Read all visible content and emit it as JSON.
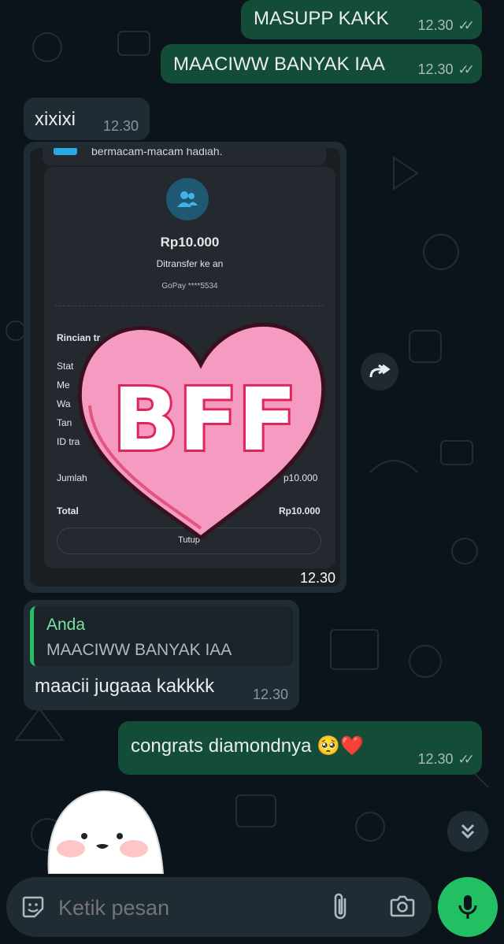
{
  "messages": [
    {
      "id": "m1",
      "direction": "out",
      "text": "MASUPP KAKK",
      "time": "12.30",
      "ticks": "✓✓"
    },
    {
      "id": "m2",
      "direction": "out",
      "text": "MAACIWW BANYAK IAA",
      "time": "12.30",
      "ticks": "✓✓"
    },
    {
      "id": "m3",
      "direction": "in",
      "text": "xixixi",
      "time": "12.30"
    },
    {
      "id": "m4",
      "direction": "in",
      "type": "image",
      "time": "12.30",
      "image": {
        "top_text": "bermacam-macam hadiah.",
        "amount": "Rp10.000",
        "transfer_label": "Ditransfer ke an",
        "account": "GoPay ****5534",
        "details_label": "Rincian tr",
        "rows": [
          "Stat",
          "Me",
          "Wa",
          "Tan",
          "ID tra"
        ],
        "jumlah_label": "Jumlah",
        "jumlah_value": "p10.000",
        "total_label": "Total",
        "total_value": "Rp10.000",
        "close_label": "Tutup",
        "sticker_text": "BFF"
      }
    },
    {
      "id": "m5",
      "direction": "in",
      "type": "reply",
      "reply": {
        "author": "Anda",
        "text": "MAACIWW BANYAK IAA"
      },
      "text": "maacii jugaaa kakkkk",
      "time": "12.30"
    },
    {
      "id": "m6",
      "direction": "out",
      "text": "congrats diamondnya 🥺❤️",
      "time": "12.30",
      "ticks": "✓✓"
    }
  ],
  "composer": {
    "placeholder": "Ketik pesan"
  },
  "icons": {
    "emoji": "sticker-emoji-icon",
    "attach": "paperclip-icon",
    "camera": "camera-icon",
    "mic": "microphone-icon",
    "forward": "forward-icon",
    "scroll": "double-chevron-down-icon"
  },
  "colors": {
    "outgoing": "#144d37",
    "incoming": "#202c33",
    "background": "#0b141a",
    "accent": "#21c063",
    "heart": "#f59ac0"
  }
}
